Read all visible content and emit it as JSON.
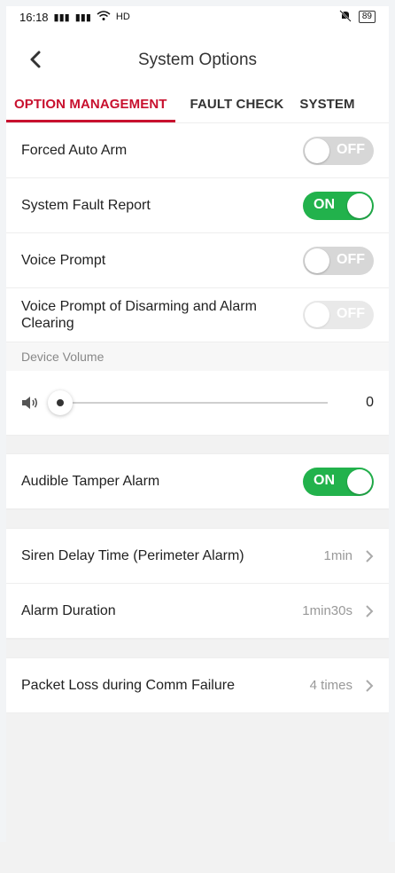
{
  "statusbar": {
    "time": "16:18",
    "signal1": "²⁶ᴵᴵ",
    "signal2": "⁴⁶ᴵᴵ",
    "wifi_label": "HD",
    "battery": "89"
  },
  "header": {
    "title": "System Options"
  },
  "tabs": [
    {
      "label": "OPTION MANAGEMENT",
      "active": true
    },
    {
      "label": "FAULT CHECK",
      "active": false
    },
    {
      "label": "SYSTEM",
      "active": false
    }
  ],
  "options": [
    {
      "label": "Forced Auto Arm",
      "state": "OFF"
    },
    {
      "label": "System Fault Report",
      "state": "ON"
    },
    {
      "label": "Voice Prompt",
      "state": "OFF"
    },
    {
      "label": "Voice Prompt of Disarming and Alarm Clearing",
      "state": "OFF"
    }
  ],
  "device_volume": {
    "section_label": "Device Volume",
    "value": "0",
    "level": 0
  },
  "tamper": {
    "label": "Audible Tamper Alarm",
    "state": "ON"
  },
  "timings": [
    {
      "label": "Siren Delay Time (Perimeter Alarm)",
      "value": "1min"
    },
    {
      "label": "Alarm Duration",
      "value": "1min30s"
    }
  ],
  "packet_loss": {
    "label": "Packet Loss during Comm Failure",
    "value": "4 times"
  },
  "colors": {
    "accent": "#c8102e",
    "toggle_on": "#22b24c",
    "toggle_off": "#d7d7d7"
  }
}
